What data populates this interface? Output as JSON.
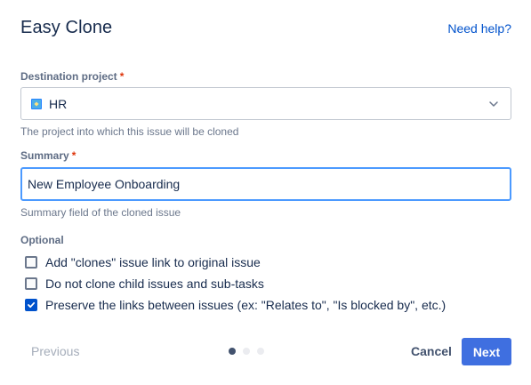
{
  "dialog": {
    "title": "Easy Clone",
    "help_link": "Need help?"
  },
  "destination": {
    "label": "Destination project",
    "required_mark": "*",
    "value": "HR",
    "project_icon": "project-avatar-icon",
    "helper": "The project into which this issue will be cloned"
  },
  "summary": {
    "label": "Summary",
    "required_mark": "*",
    "value": "New Employee Onboarding",
    "helper": "Summary field of the cloned issue"
  },
  "optional": {
    "label": "Optional",
    "options": [
      {
        "label": "Add \"clones\" issue link to original issue",
        "checked": false
      },
      {
        "label": "Do not clone child issues and sub-tasks",
        "checked": false
      },
      {
        "label": "Preserve the links between issues (ex: \"Relates to\", \"Is blocked by\", etc.)",
        "checked": true
      }
    ]
  },
  "footer": {
    "previous_label": "Previous",
    "cancel_label": "Cancel",
    "next_label": "Next",
    "current_step": 1,
    "total_steps": 3
  },
  "colors": {
    "primary": "#3f6fe0",
    "link": "#0052cc",
    "required": "#de350b",
    "focus_border": "#4c9aff"
  }
}
